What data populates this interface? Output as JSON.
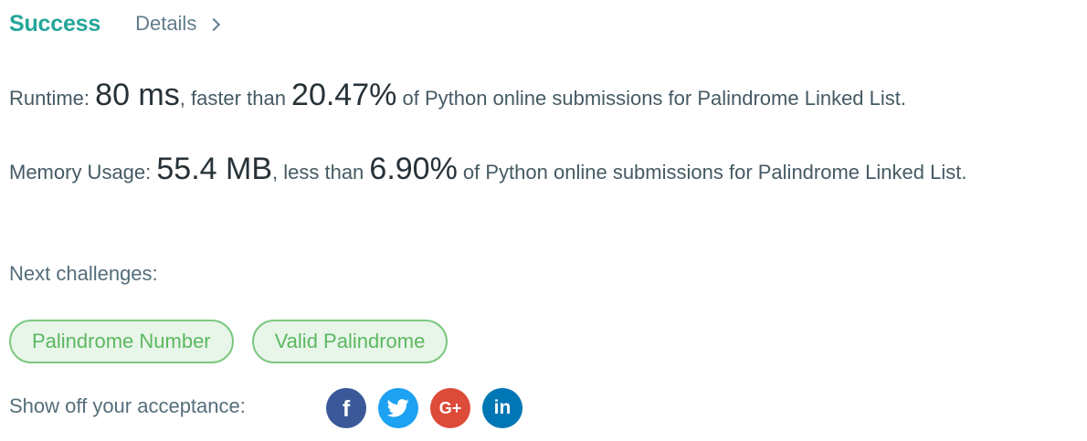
{
  "header": {
    "status": "Success",
    "details_label": "Details"
  },
  "runtime": {
    "label": "Runtime: ",
    "value": "80 ms",
    "comparison": ", faster than ",
    "percent": "20.47%",
    "suffix": " of Python online submissions for Palindrome Linked List."
  },
  "memory": {
    "label": "Memory Usage: ",
    "value": "55.4 MB",
    "comparison": ", less than ",
    "percent": "6.90%",
    "suffix": " of Python online submissions for Palindrome Linked List."
  },
  "next": {
    "label": "Next challenges:",
    "challenges": [
      "Palindrome Number",
      "Valid Palindrome"
    ]
  },
  "share": {
    "label": "Show off your acceptance:",
    "icons": [
      {
        "name": "facebook-icon",
        "color": "#3b5998",
        "glyph": "f"
      },
      {
        "name": "twitter-icon",
        "color": "#1da1f2"
      },
      {
        "name": "google-plus-icon",
        "color": "#dd4b39",
        "glyph": "G+"
      },
      {
        "name": "linkedin-icon",
        "color": "#0077b5",
        "glyph": "in"
      }
    ]
  },
  "colors": {
    "success": "#26a69a",
    "chip_border": "#7bc87f",
    "chip_bg": "#e8f5e9",
    "chip_text": "#5cb860"
  }
}
